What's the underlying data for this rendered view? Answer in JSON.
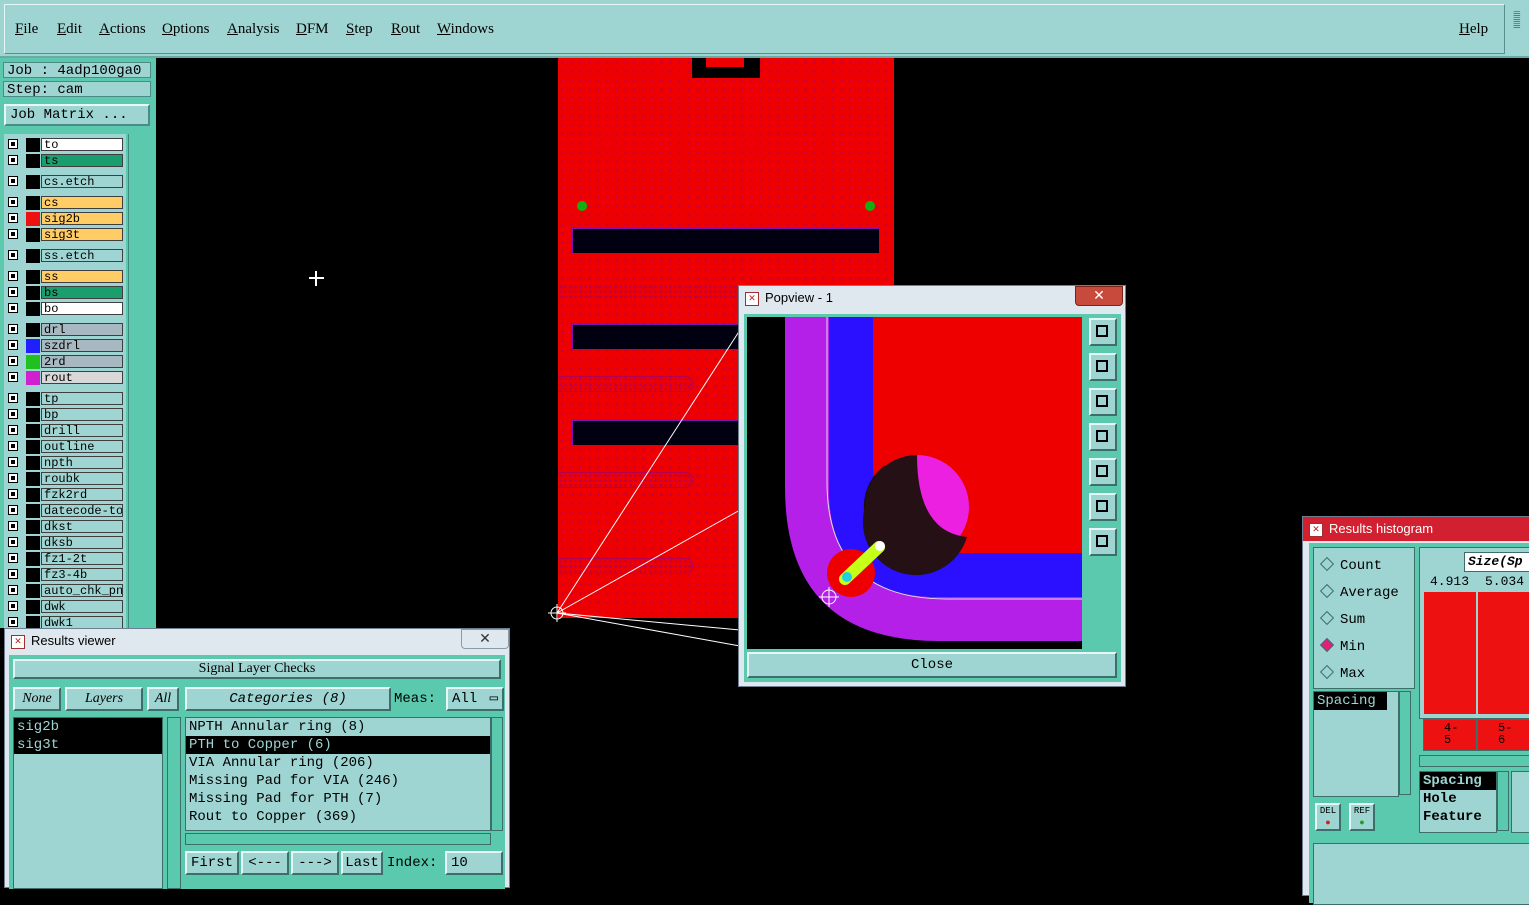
{
  "menu": {
    "items": [
      "File",
      "Edit",
      "Actions",
      "Options",
      "Analysis",
      "DFM",
      "Step",
      "Rout",
      "Windows"
    ],
    "help": "Help"
  },
  "job": {
    "job_label": "Job : 4adp100ga0",
    "step_label": "Step: cam",
    "matrix_button": "Job Matrix ..."
  },
  "layers": [
    {
      "name": "to",
      "color": "#ffffff",
      "swatch": "#000000"
    },
    {
      "name": "ts",
      "color": "#1a9e6e",
      "swatch": "#000000"
    },
    {
      "name": "cs.etch",
      "color": "#9ed5d2",
      "swatch": "#000000"
    },
    {
      "name": "cs",
      "color": "#ffcc66",
      "swatch": "#000000"
    },
    {
      "name": "sig2b",
      "color": "#ffcc66",
      "swatch": "#ee1111"
    },
    {
      "name": "sig3t",
      "color": "#ffcc66",
      "swatch": "#000000"
    },
    {
      "name": "ss.etch",
      "color": "#9ed5d2",
      "swatch": "#000000"
    },
    {
      "name": "ss",
      "color": "#ffcc66",
      "swatch": "#000000"
    },
    {
      "name": "bs",
      "color": "#1a9e6e",
      "swatch": "#000000"
    },
    {
      "name": "bo",
      "color": "#ffffff",
      "swatch": "#000000"
    },
    {
      "name": "drl",
      "color": "#a8b8c0",
      "swatch": "#000000"
    },
    {
      "name": "szdrl",
      "color": "#a8b8c0",
      "swatch": "#2020ff"
    },
    {
      "name": "2rd",
      "color": "#a8b8c0",
      "swatch": "#20c020"
    },
    {
      "name": "rout",
      "color": "#d8d8d8",
      "swatch": "#d020d0"
    },
    {
      "name": "tp",
      "color": "#9ed5d2",
      "swatch": "#000000"
    },
    {
      "name": "bp",
      "color": "#9ed5d2",
      "swatch": "#000000"
    },
    {
      "name": "drill",
      "color": "#9ed5d2",
      "swatch": "#000000"
    },
    {
      "name": "outline",
      "color": "#9ed5d2",
      "swatch": "#000000"
    },
    {
      "name": "npth",
      "color": "#9ed5d2",
      "swatch": "#000000"
    },
    {
      "name": "roubk",
      "color": "#9ed5d2",
      "swatch": "#000000"
    },
    {
      "name": "fzk2rd",
      "color": "#9ed5d2",
      "swatch": "#000000"
    },
    {
      "name": "datecode-to",
      "color": "#9ed5d2",
      "swatch": "#000000"
    },
    {
      "name": "dkst",
      "color": "#9ed5d2",
      "swatch": "#000000"
    },
    {
      "name": "dksb",
      "color": "#9ed5d2",
      "swatch": "#000000"
    },
    {
      "name": "fz1-2t",
      "color": "#9ed5d2",
      "swatch": "#000000"
    },
    {
      "name": "fz3-4b",
      "color": "#9ed5d2",
      "swatch": "#000000"
    },
    {
      "name": "auto_chk_pn",
      "color": "#9ed5d2",
      "swatch": "#000000"
    },
    {
      "name": "dwk",
      "color": "#9ed5d2",
      "swatch": "#000000"
    },
    {
      "name": "dwk1",
      "color": "#9ed5d2",
      "swatch": "#000000"
    }
  ],
  "popview": {
    "title": "Popview - 1",
    "close_label": "Close"
  },
  "results_viewer": {
    "title": "Results viewer",
    "header": "Signal Layer Checks",
    "none_btn": "None",
    "layers_btn": "Layers",
    "all_btn": "All",
    "categories_btn": "Categories (8)",
    "meas_label": "Meas:",
    "meas_value": "All",
    "layer_list": [
      "sig2b",
      "sig3t"
    ],
    "categories": [
      "NPTH Annular ring (8)",
      "PTH to Copper (6)",
      "VIA Annular ring (206)",
      "Missing Pad for VIA (246)",
      "Missing Pad for PTH (7)",
      "Rout to Copper (369)"
    ],
    "selected_category": 1,
    "first_btn": "First",
    "prev_btn": "<---",
    "next_btn": "--->",
    "last_btn": "Last",
    "index_label": "Index:",
    "index_value": "10"
  },
  "histogram": {
    "title": "Results histogram",
    "modes": [
      "Count",
      "Average",
      "Sum",
      "Min",
      "Max"
    ],
    "selected_mode": "Min",
    "list_item": "Spacing",
    "size_label": "Size(Sp",
    "bar_values": [
      "4.913",
      "5.034"
    ],
    "bin_labels": [
      "4-\n5",
      "5-\n6"
    ],
    "types": [
      "Spacing",
      "Hole",
      "Feature"
    ],
    "del_btn": "DEL",
    "ref_btn": "REF"
  }
}
